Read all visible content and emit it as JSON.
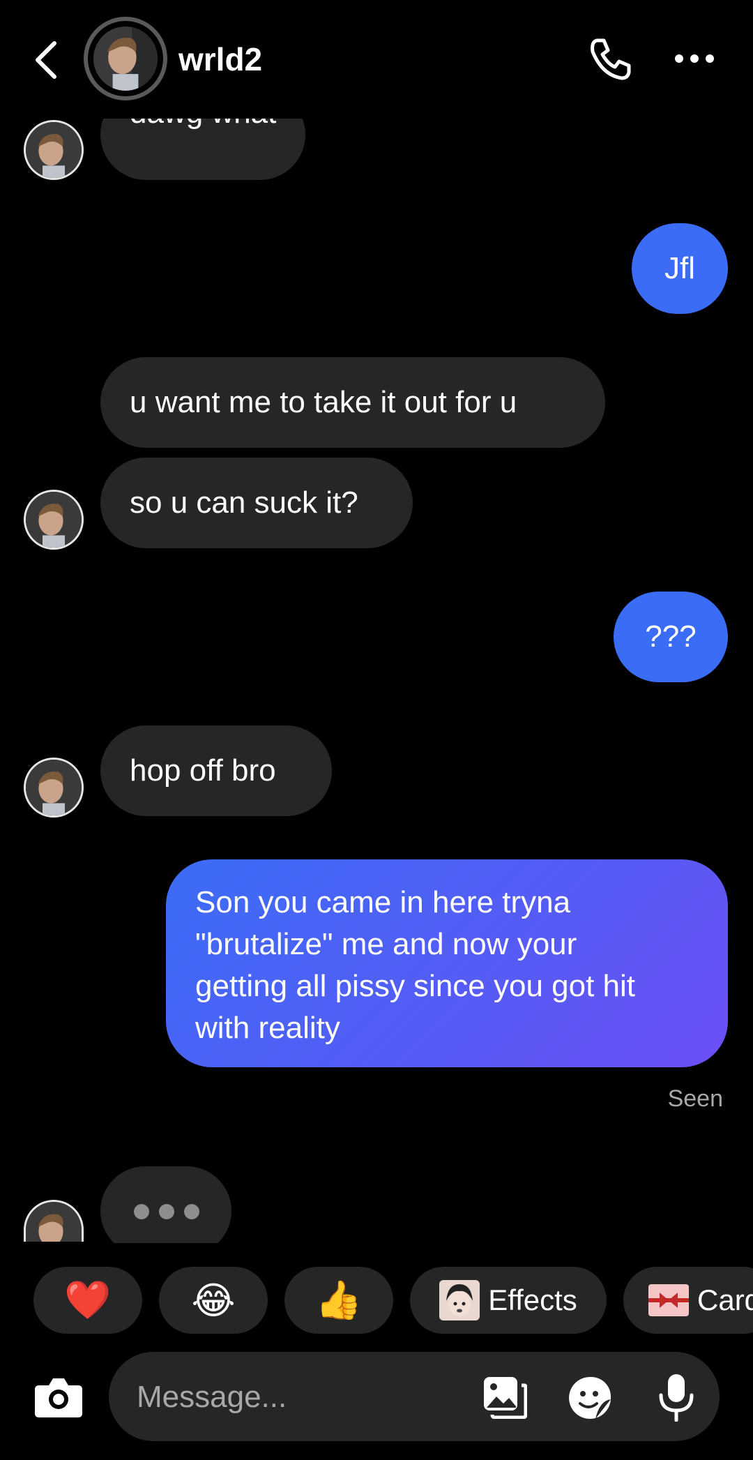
{
  "header": {
    "username": "wrld2"
  },
  "messages": [
    {
      "side": "received",
      "text": "dawg what"
    },
    {
      "side": "sent",
      "text": "Jfl"
    },
    {
      "side": "received",
      "text": "u want me to take it out for u"
    },
    {
      "side": "received",
      "text": "so u can suck it?"
    },
    {
      "side": "sent",
      "text": "???"
    },
    {
      "side": "received",
      "text": "hop off bro"
    },
    {
      "side": "sent",
      "lines": [
        "Son you came in here tryna",
        "\"brutalize\" me and now your",
        "getting all pissy since you got hit",
        "with reality"
      ]
    }
  ],
  "seen_label": "Seen",
  "quick_reactions": {
    "heart": "❤️",
    "laugh": "😂",
    "thumbs_up": "👍",
    "effects_label": "Effects",
    "cards_label": "Card"
  },
  "composer": {
    "placeholder": "Message..."
  },
  "colors": {
    "sent_bubble": "#3b6cf6",
    "sent_gradient_end": "#6a4ff4",
    "received_bubble": "#262626",
    "background": "#000000"
  },
  "icons": [
    "back-chevron-icon",
    "phone-icon",
    "more-icon",
    "camera-icon",
    "gallery-icon",
    "sticker-icon",
    "microphone-icon"
  ]
}
